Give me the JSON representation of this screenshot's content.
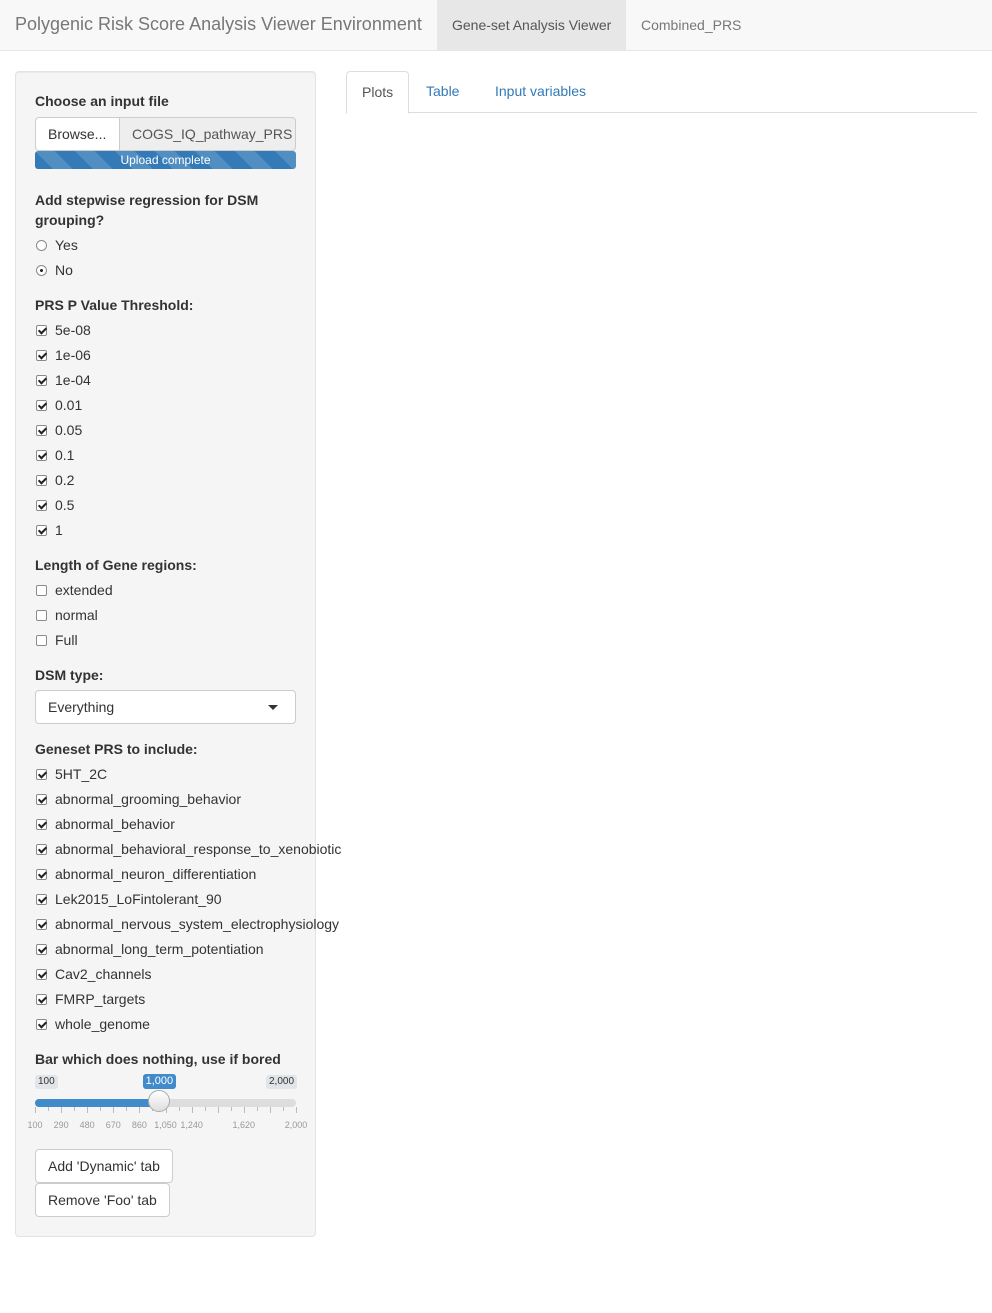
{
  "navbar": {
    "brand": "Polygenic Risk Score Analysis Viewer Environment",
    "tabs": [
      {
        "label": "Gene-set Analysis Viewer",
        "active": true
      },
      {
        "label": "Combined_PRS",
        "active": false
      }
    ]
  },
  "sidebar": {
    "file_input": {
      "label": "Choose an input file",
      "browse_label": "Browse...",
      "file_name": "COGS_IQ_pathway_PRS",
      "progress_text": "Upload complete",
      "progress": 1.0
    },
    "stepwise": {
      "label": "Add stepwise regression for DSM grouping?",
      "line1": "Add stepwise regression for DSM",
      "line2": "grouping?",
      "options": [
        {
          "label": "Yes",
          "selected": false
        },
        {
          "label": "No",
          "selected": true
        }
      ]
    },
    "pvalue": {
      "label": "PRS P Value Threshold:",
      "options": [
        {
          "label": "5e-08",
          "checked": true
        },
        {
          "label": "1e-06",
          "checked": true
        },
        {
          "label": "1e-04",
          "checked": true
        },
        {
          "label": "0.01",
          "checked": true
        },
        {
          "label": "0.05",
          "checked": true
        },
        {
          "label": "0.1",
          "checked": true
        },
        {
          "label": "0.2",
          "checked": true
        },
        {
          "label": "0.5",
          "checked": true
        },
        {
          "label": "1",
          "checked": true
        }
      ]
    },
    "gene_regions": {
      "label": "Length of Gene regions:",
      "options": [
        {
          "label": "extended",
          "checked": false
        },
        {
          "label": "normal",
          "checked": false
        },
        {
          "label": "Full",
          "checked": false
        }
      ]
    },
    "dsm_type": {
      "label": "DSM type:",
      "selected": "Everything"
    },
    "geneset": {
      "label": "Geneset PRS to include:",
      "options": [
        {
          "label": "5HT_2C",
          "checked": true
        },
        {
          "label": "abnormal_grooming_behavior",
          "checked": true
        },
        {
          "label": "abnormal_behavior",
          "checked": true
        },
        {
          "label": "abnormal_behavioral_response_to_xenobiotic",
          "checked": true
        },
        {
          "label": "abnormal_neuron_differentiation",
          "checked": true
        },
        {
          "label": "Lek2015_LoFintolerant_90",
          "checked": true
        },
        {
          "label": "abnormal_nervous_system_electrophysiology",
          "checked": true
        },
        {
          "label": "abnormal_long_term_potentiation",
          "checked": true
        },
        {
          "label": "Cav2_channels",
          "checked": true
        },
        {
          "label": "FMRP_targets",
          "checked": true
        },
        {
          "label": "whole_genome",
          "checked": true
        }
      ]
    },
    "slider": {
      "label": "Bar which does nothing, use if bored",
      "min": 100,
      "max": 2000,
      "value": 1000,
      "min_label": "100",
      "max_label": "2,000",
      "value_label": "1,000",
      "tick_labels": [
        "100",
        "290",
        "480",
        "670",
        "860",
        "1,050",
        "1,240",
        "1,620",
        "2,000"
      ]
    },
    "buttons": {
      "add_dynamic": "Add 'Dynamic' tab",
      "remove_foo": "Remove 'Foo' tab"
    }
  },
  "main": {
    "tabs": [
      {
        "label": "Plots",
        "active": true
      },
      {
        "label": "Table",
        "active": false
      },
      {
        "label": "Input variables",
        "active": false
      }
    ]
  }
}
